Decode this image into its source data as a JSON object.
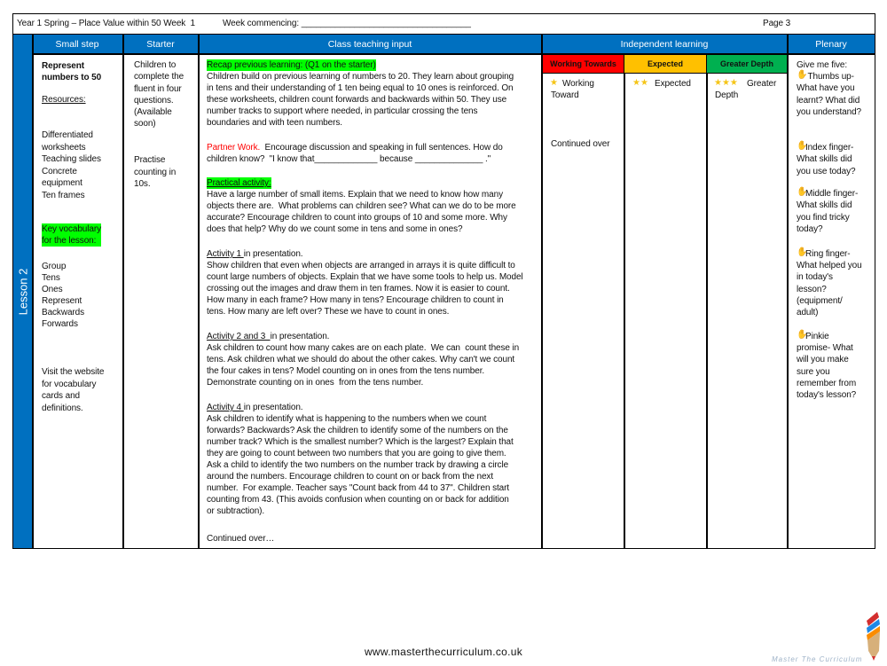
{
  "header": {
    "title": "Year 1 Spring – Place Value within 50 Week  1",
    "week": "Week commencing: ___________________________________",
    "page": "Page 3"
  },
  "lesson_label": "Lesson 2",
  "columns": {
    "small_step": "Small step",
    "starter": "Starter",
    "class_input": "Class teaching input",
    "independent": "Independent learning",
    "plenary": "Plenary"
  },
  "levels": {
    "wt": {
      "label": "Working Towards",
      "color": "#ff0000",
      "text": "Working\nToward",
      "note": "Continued over"
    },
    "exp": {
      "label": "Expected",
      "color": "#ffc000",
      "text": "Expected"
    },
    "gd": {
      "label": "Greater Depth",
      "color": "#00b050",
      "text": "Greater\nDepth"
    }
  },
  "small_step": {
    "title": "Represent\nnumbers to 50",
    "resources_label": "Resources:",
    "resources": "Differentiated\nworksheets\nTeaching slides\nConcrete\nequipment\nTen frames",
    "vocab_label": "Key vocabulary\nfor the lesson:",
    "vocab": "Group\nTens\nOnes\nRepresent\nBackwards\nForwards",
    "website": "Visit the website\nfor vocabulary\ncards and\ndefinitions."
  },
  "starter": {
    "p1": "Children to\ncomplete the\nfluent in four\nquestions.\n(Available\nsoon)",
    "p2": "Practise\ncounting in\n10s."
  },
  "class_input": {
    "recap_label": "Recap previous learning: (Q1 on the starter)",
    "recap": "Children build on previous learning of numbers to 20. They learn about grouping\nin tens and their understanding of 1 ten being equal to 10 ones is reinforced. On\nthese worksheets, children count forwards and backwards within 50. They use\nnumber tracks to support where needed, in particular crossing the tens\nboundaries and with teen numbers.",
    "partner_label": "Partner Work.",
    "partner": "  Encourage discussion and speaking in full sentences. How do\nchildren know?  \"I know that_____________ because ______________ .\"",
    "practical_label": "Practical activity:",
    "practical": "Have a large number of small items. Explain that we need to know how many\nobjects there are.  What problems can children see? What can we do to be more\naccurate? Encourage children to count into groups of 10 and some more. Why\ndoes that help? Why do we count some in tens and some in ones?",
    "a1_label": "Activity 1 ",
    "a1_suffix": "in presentation.",
    "a1": "Show children that even when objects are arranged in arrays it is quite difficult to\ncount large numbers of objects. Explain that we have some tools to help us. Model\ncrossing out the images and draw them in ten frames. Now it is easier to count.\nHow many in each frame? How many in tens? Encourage children to count in\ntens. How many are left over? These we have to count in ones.",
    "a2_label": "Activity 2 and 3  ",
    "a2_suffix": "in presentation.",
    "a2": "Ask children to count how many cakes are on each plate.  We can  count these in\ntens. Ask children what we should do about the other cakes. Why can't we count\nthe four cakes in tens? Model counting on in ones from the tens number.\nDemonstrate counting on in ones  from the tens number.",
    "a4_label": "Activity 4 ",
    "a4_suffix": "in presentation.",
    "a4": "Ask children to identify what is happening to the numbers when we count\nforwards? Backwards? Ask the children to identify some of the numbers on the\nnumber track? Which is the smallest number? Which is the largest? Explain that\nthey are going to count between two numbers that you are going to give them.\nAsk a child to identify the two numbers on the number track by drawing a circle\naround the numbers. Encourage children to count on or back from the next\nnumber.  For example. Teacher says \"Count back from 44 to 37\". Children start\ncounting from 43. (This avoids confusion when counting on or back for addition\nor subtraction).",
    "continued": "Continued over…"
  },
  "plenary": {
    "intro": "Give me five:",
    "thumb": " Thumbs up-\nWhat have you\nlearnt? What did\nyou understand?",
    "index": "Index finger-\nWhat skills did\nyou use today?",
    "middle": "Middle finger-\nWhat skills did\nyou find tricky\ntoday?",
    "ring": "Ring finger-\nWhat helped you\nin today's\nlesson?\n(equipment/\nadult)",
    "pinkie": "Pinkie\npromise- What\nwill you make\nsure you\nremember from\ntoday's lesson?"
  },
  "footer": {
    "url": "www.masterthecurriculum.co.uk",
    "logo_text": "Master The Curriculum"
  }
}
